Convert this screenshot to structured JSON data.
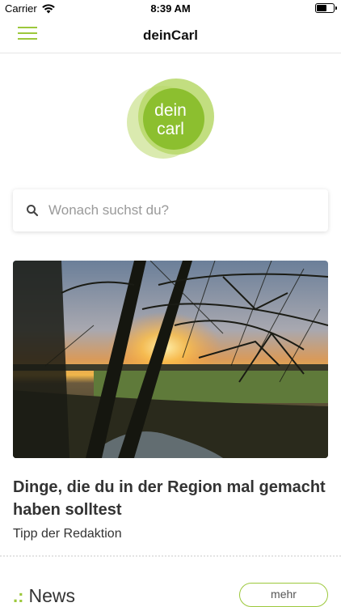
{
  "status_bar": {
    "carrier": "Carrier",
    "time": "8:39 AM"
  },
  "nav": {
    "title": "deinCarl",
    "accent_color": "#9cc83c"
  },
  "logo": {
    "line1": "dein",
    "line2": "carl"
  },
  "search": {
    "placeholder": "Wonach suchst du?"
  },
  "featured_article": {
    "title": "Dinge, die du in der Region mal gemacht haben solltest",
    "subtitle": "Tipp der Redaktion"
  },
  "news_section": {
    "prefix": ".:",
    "heading": "News",
    "more_label": "mehr"
  }
}
